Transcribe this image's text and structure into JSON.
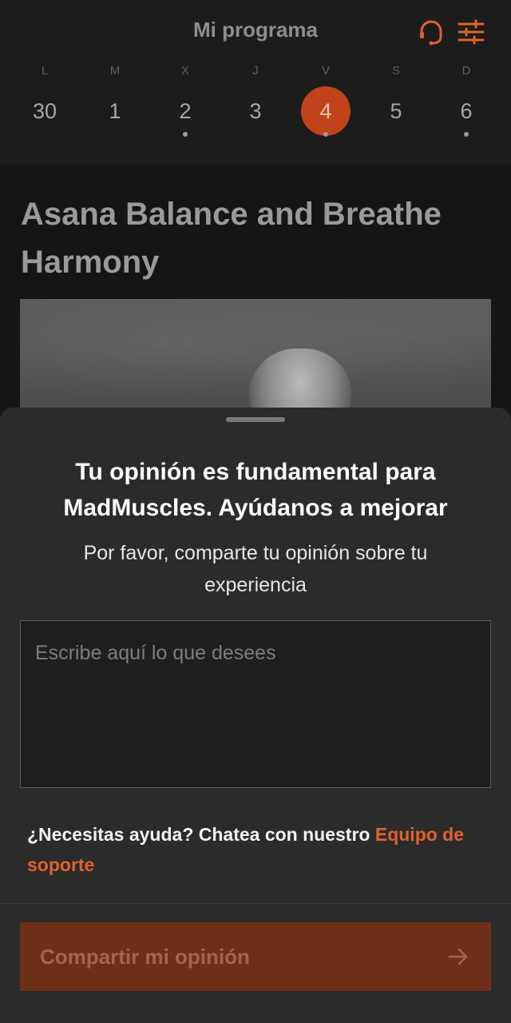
{
  "header": {
    "title": "Mi programa",
    "icons": [
      "headset-icon",
      "sliders-icon"
    ],
    "accent_color": "#e2622c"
  },
  "week": {
    "days": [
      {
        "letter": "L",
        "number": "30",
        "selected": false,
        "dot": false
      },
      {
        "letter": "M",
        "number": "1",
        "selected": false,
        "dot": false
      },
      {
        "letter": "X",
        "number": "2",
        "selected": false,
        "dot": true
      },
      {
        "letter": "J",
        "number": "3",
        "selected": false,
        "dot": false
      },
      {
        "letter": "V",
        "number": "4",
        "selected": true,
        "dot": true
      },
      {
        "letter": "S",
        "number": "5",
        "selected": false,
        "dot": false
      },
      {
        "letter": "D",
        "number": "6",
        "selected": false,
        "dot": true
      }
    ],
    "selected_color": "#c0431a"
  },
  "workout": {
    "title": "Asana Balance and Breathe Harmony"
  },
  "feedback_sheet": {
    "title": "Tu opinión es fundamental para MadMuscles. Ayúdanos a mejorar",
    "subtitle": "Por favor, comparte tu opinión sobre tu experiencia",
    "input_placeholder": "Escribe aquí lo que desees",
    "input_value": "",
    "help_text": "¿Necesitas ayuda? Chatea con nuestro ",
    "help_link": "Equipo de soporte",
    "submit_label": "Compartir mi opinión",
    "submit_icon": "arrow-right-icon",
    "submit_color": "#6e2f18"
  }
}
